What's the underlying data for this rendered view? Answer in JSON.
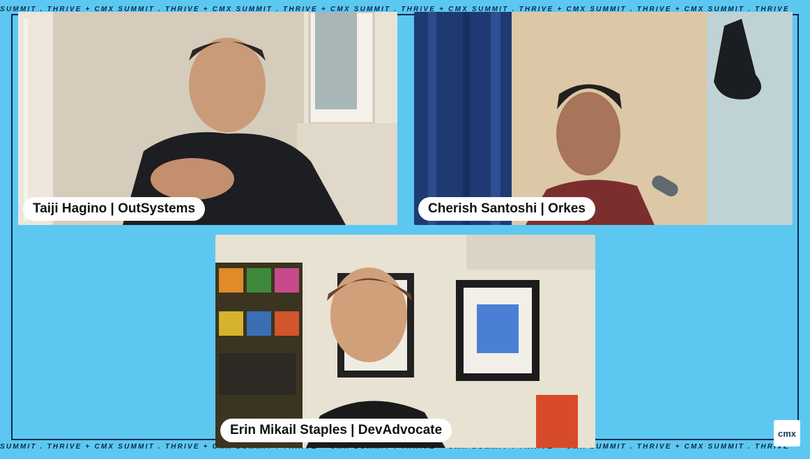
{
  "event": {
    "ticker_text": "SUMMIT . THRIVE  +  CMX SUMMIT . THRIVE  +  CMX SUMMIT . THRIVE  +  CMX SUMMIT . THRIVE  +  CMX SUMMIT . THRIVE  +  CMX SUMMIT . THRIVE  +  CMX SUMMIT . THRIVE",
    "logo_text": "cmx",
    "brand_color": "#5cc8f2",
    "border_color": "#0b2a4a"
  },
  "participants": [
    {
      "name": "Taiji Hagino | OutSystems"
    },
    {
      "name": "Cherish Santoshi | Orkes"
    },
    {
      "name": "Erin Mikail Staples | DevAdvocate"
    }
  ]
}
